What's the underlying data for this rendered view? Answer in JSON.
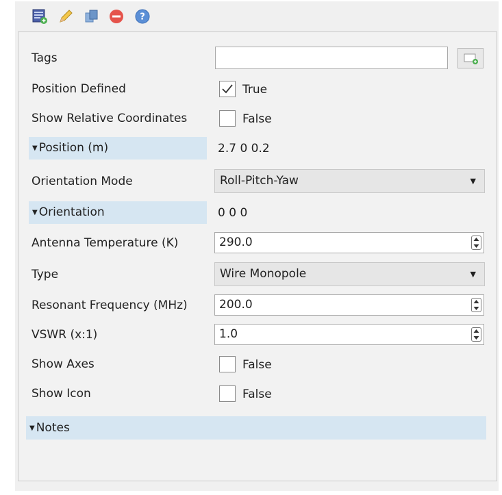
{
  "toolbar": {
    "icons": [
      "properties-icon",
      "edit-icon",
      "copy-icon",
      "delete-icon",
      "help-icon"
    ]
  },
  "properties": {
    "tags": {
      "label": "Tags",
      "value": ""
    },
    "position_defined": {
      "label": "Position Defined",
      "checked": true,
      "text": "True"
    },
    "show_relative_coordinates": {
      "label": "Show Relative Coordinates",
      "checked": false,
      "text": "False"
    },
    "position": {
      "label": "Position (m)",
      "value": "2.7 0 0.2"
    },
    "orientation_mode": {
      "label": "Orientation Mode",
      "value": "Roll-Pitch-Yaw"
    },
    "orientation": {
      "label": "Orientation",
      "value": "0 0 0"
    },
    "antenna_temperature": {
      "label": "Antenna Temperature (K)",
      "value": "290.0"
    },
    "type": {
      "label": "Type",
      "value": "Wire Monopole"
    },
    "resonant_frequency": {
      "label": "Resonant Frequency (MHz)",
      "value": "200.0"
    },
    "vswr": {
      "label": "VSWR (x:1)",
      "value": "1.0"
    },
    "show_axes": {
      "label": "Show Axes",
      "checked": false,
      "text": "False"
    },
    "show_icon": {
      "label": "Show Icon",
      "checked": false,
      "text": "False"
    },
    "notes": {
      "label": "Notes"
    }
  }
}
